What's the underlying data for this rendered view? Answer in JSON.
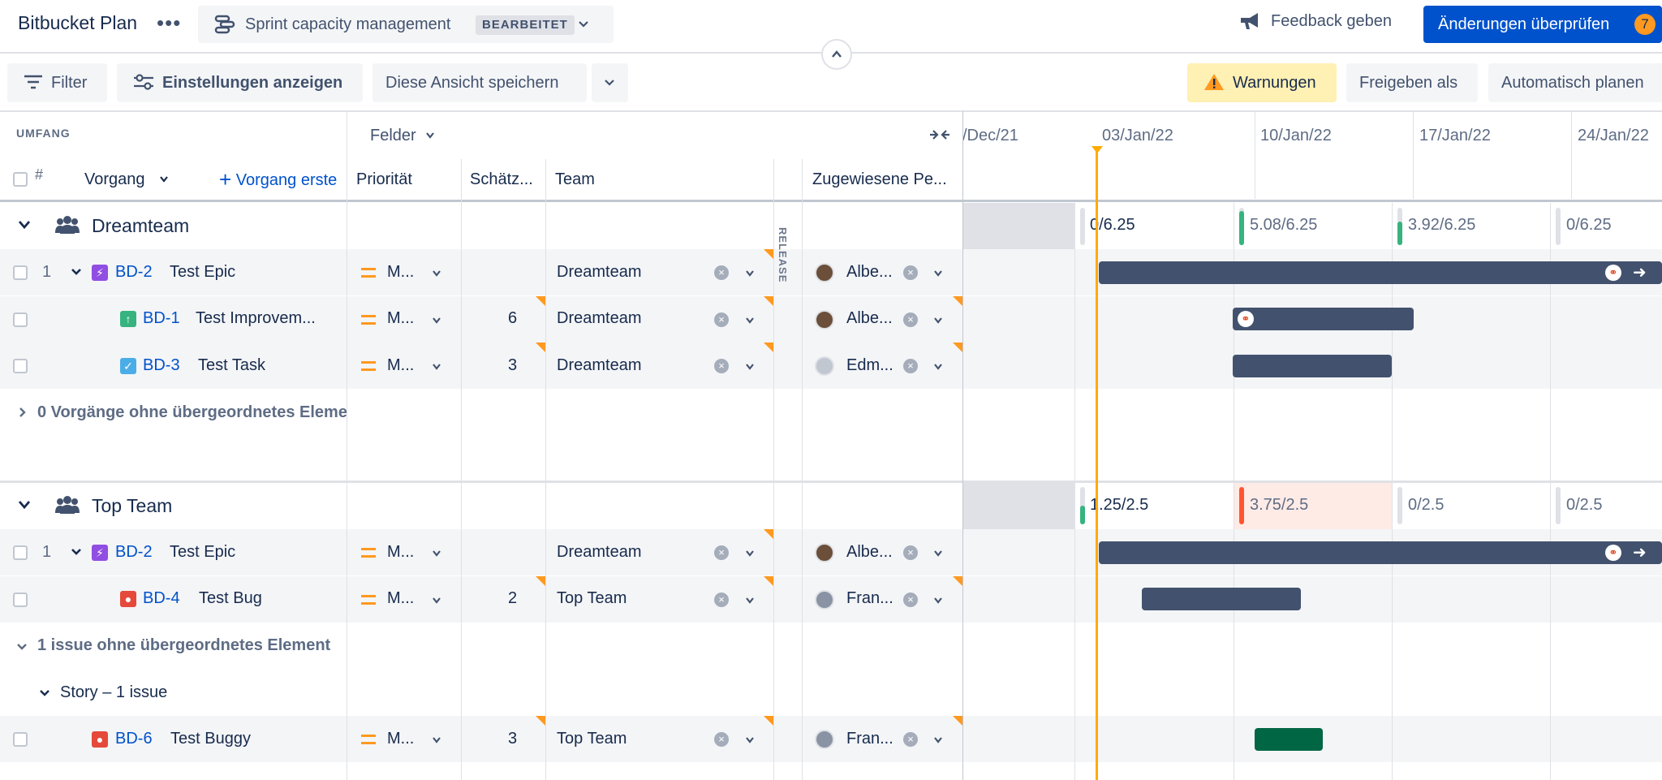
{
  "header": {
    "app_title": "Bitbucket Plan",
    "more": "•••",
    "plan_name": "Sprint capacity management",
    "plan_badge": "BEARBEITET",
    "feedback": "Feedback geben",
    "review": "Änderungen überprüfen",
    "review_count": "7"
  },
  "toolbar": {
    "filter": "Filter",
    "settings": "Einstellungen anzeigen",
    "save_view": "Diese Ansicht speichern",
    "warnings": "Warnungen",
    "share": "Freigeben als",
    "auto_schedule": "Automatisch planen"
  },
  "grid": {
    "scope_label": "UMFANG",
    "fields_label": "Felder",
    "hash": "#",
    "issue_col": "Vorgang",
    "create_issue": "Vorgang erste",
    "priority_col": "Priorität",
    "estimate_col": "Schätz...",
    "team_col": "Team",
    "release_label": "RELEASE",
    "assignee_col": "Zugewiesene Pe..."
  },
  "timeline": {
    "dates": [
      "/Dec/21",
      "03/Jan/22",
      "10/Jan/22",
      "17/Jan/22",
      "24/Jan/22"
    ]
  },
  "groups": [
    {
      "name": "Dreamteam",
      "capacity": [
        "0/6.25",
        "5.08/6.25",
        "3.92/6.25",
        "0/6.25"
      ],
      "rows": [
        {
          "num": "1",
          "key": "BD-2",
          "title": "Test Epic",
          "priority": "M...",
          "estimate": "",
          "team": "Dreamteam",
          "assignee": "Albe..."
        },
        {
          "num": "",
          "key": "BD-1",
          "title": "Test Improvem...",
          "priority": "M...",
          "estimate": "6",
          "team": "Dreamteam",
          "assignee": "Albe..."
        },
        {
          "num": "",
          "key": "BD-3",
          "title": "Test Task",
          "priority": "M...",
          "estimate": "3",
          "team": "Dreamteam",
          "assignee": "Edm..."
        }
      ],
      "orphan": "0 Vorgänge ohne übergeordnetes Eleme"
    },
    {
      "name": "Top Team",
      "capacity": [
        "1.25/2.5",
        "3.75/2.5",
        "0/2.5",
        "0/2.5"
      ],
      "rows": [
        {
          "num": "1",
          "key": "BD-2",
          "title": "Test Epic",
          "priority": "M...",
          "estimate": "",
          "team": "Dreamteam",
          "assignee": "Albe..."
        },
        {
          "num": "",
          "key": "BD-4",
          "title": "Test Bug",
          "priority": "M...",
          "estimate": "2",
          "team": "Top Team",
          "assignee": "Fran..."
        }
      ],
      "orphan": "1 issue ohne übergeordnetes Element",
      "story_group": "Story – 1 issue",
      "extra_row": {
        "key": "BD-6",
        "title": "Test Buggy",
        "priority": "M...",
        "estimate": "3",
        "team": "Top Team",
        "assignee": "Fran..."
      }
    }
  ],
  "colors": {
    "primary": "#0052cc",
    "bar": "#42526e",
    "bar_green": "#006644",
    "today": "#ffab00",
    "warn_bg": "#fff0b3",
    "over_capacity": "#ff5630"
  }
}
